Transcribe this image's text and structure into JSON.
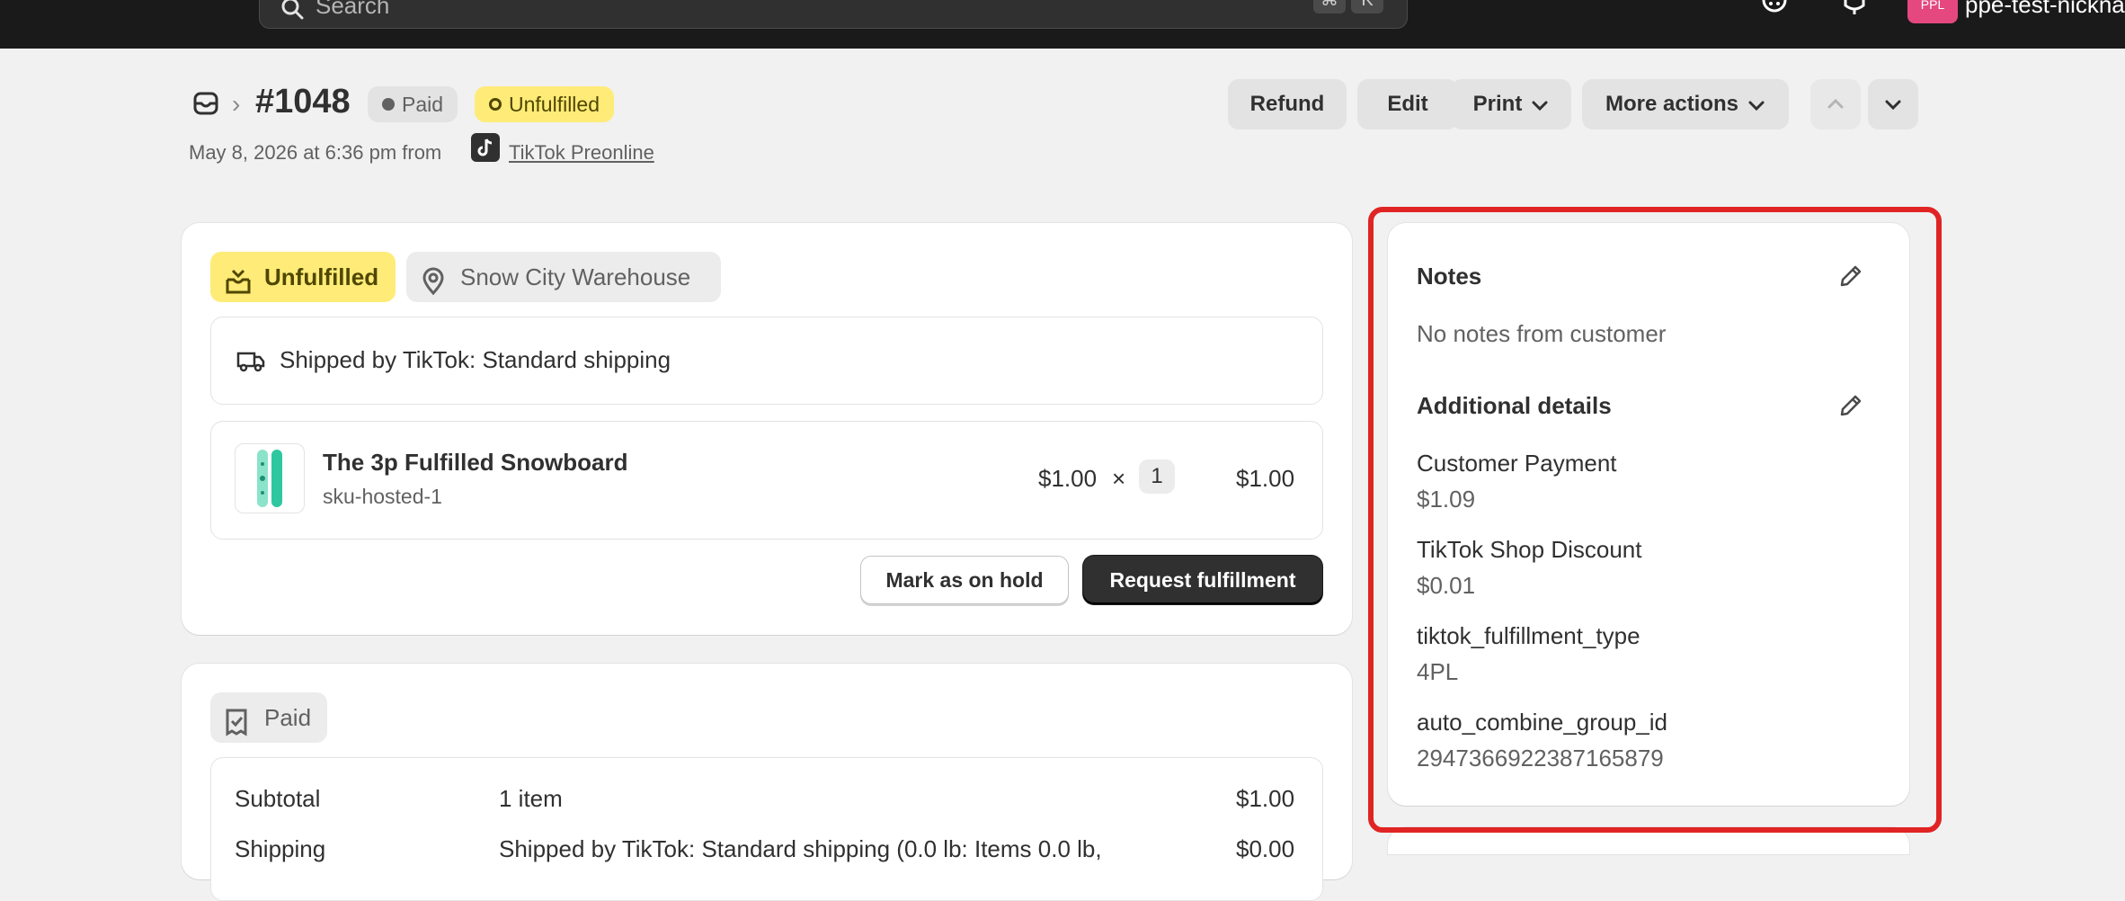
{
  "topbar": {
    "search_placeholder": "Search",
    "shortcut_keys": [
      "⌘",
      "K"
    ],
    "avatar_initials": "PPL",
    "shop_name": "ppe-test-nickname"
  },
  "header": {
    "order_number": "#1048",
    "badges": {
      "payment": "Paid",
      "fulfillment": "Unfulfilled"
    },
    "subtitle": "May 8, 2026 at 6:36 pm from",
    "source": "TikTok Preonline",
    "buttons": {
      "refund": "Refund",
      "edit": "Edit",
      "print": "Print",
      "more_actions": "More actions"
    }
  },
  "fulfillment": {
    "status": "Unfulfilled",
    "location": "Snow City Warehouse",
    "shipping_method": "Shipped by TikTok: Standard shipping",
    "line_item": {
      "title": "The 3p Fulfilled Snowboard",
      "sku": "sku-hosted-1",
      "unit_price": "$1.00",
      "times": "×",
      "quantity": "1",
      "total": "$1.00"
    },
    "buttons": {
      "hold": "Mark as on hold",
      "request": "Request fulfillment"
    }
  },
  "payment": {
    "status": "Paid",
    "rows": [
      {
        "label": "Subtotal",
        "detail": "1 item",
        "amount": "$1.00"
      },
      {
        "label": "Shipping",
        "detail": "Shipped by TikTok: Standard shipping (0.0 lb: Items 0.0 lb,",
        "amount": "$0.00"
      }
    ]
  },
  "notes": {
    "title": "Notes",
    "empty_text": "No notes from customer",
    "additional_title": "Additional details",
    "details": [
      {
        "label": "Customer Payment",
        "value": "$1.09"
      },
      {
        "label": "TikTok Shop Discount",
        "value": "$0.01"
      },
      {
        "label": "tiktok_fulfillment_type",
        "value": "4PL"
      },
      {
        "label": "auto_combine_group_id",
        "value": "2947366922387165879"
      }
    ]
  },
  "colors": {
    "page_bg": "#f1f1f1",
    "topbar_bg": "#1a1a1a",
    "unfulfilled_badge": "#ffeb78",
    "primary_button": "#303030",
    "highlight_border": "#e02424"
  },
  "icons": [
    "search-icon",
    "gift-icon",
    "bell-icon",
    "inbox-icon",
    "tiktok-icon",
    "chevron-down-icon",
    "chevron-up-icon",
    "package-icon",
    "location-pin-icon",
    "truck-icon",
    "receipt-icon",
    "pencil-icon"
  ]
}
